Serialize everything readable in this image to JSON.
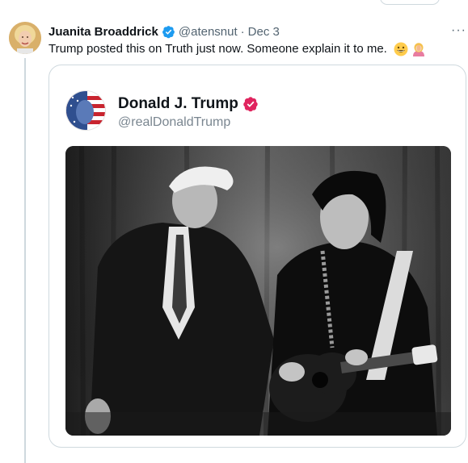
{
  "tweet": {
    "author_name": "Juanita Broaddrick",
    "handle": "@atensnut",
    "separator": "·",
    "date": "Dec 3",
    "text": "Trump posted this on Truth just now. Someone explain it to me.",
    "emojis": [
      "grinning-face-emoji",
      "person-facepalming-emoji"
    ],
    "verified_color": "#1d9bf0",
    "more_glyph": "···"
  },
  "quote": {
    "author_name": "Donald J. Trump",
    "handle": "@realDonaldTrump",
    "badge_color": "#e0245e",
    "image_description": "Black-and-white image of Donald Trump standing beside Elvis Presley playing an acoustic guitar on stage"
  },
  "colors": {
    "text_primary": "#0f1419",
    "text_secondary": "#536471",
    "border": "#cfd9de"
  }
}
